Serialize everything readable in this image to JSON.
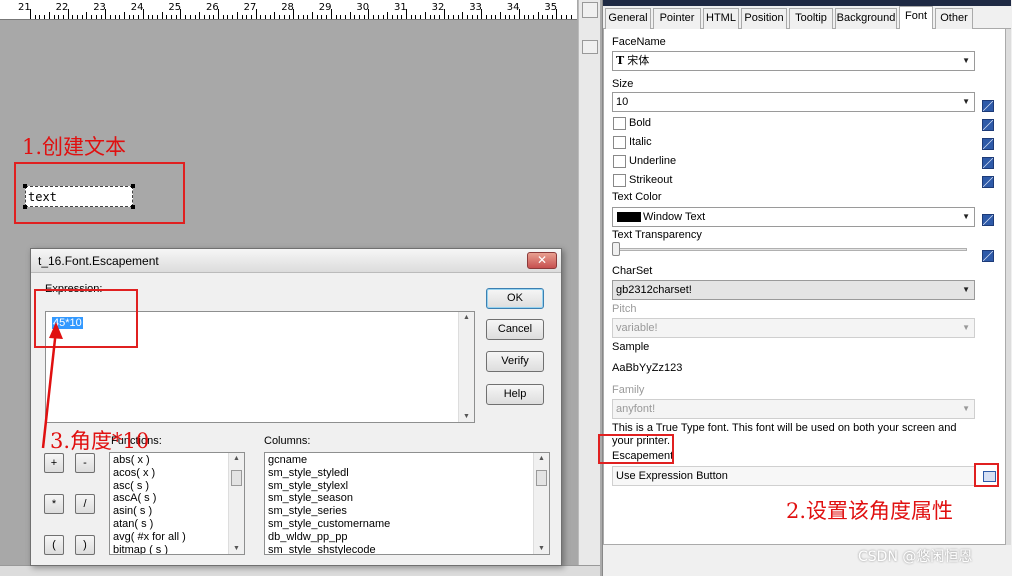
{
  "ruler": {
    "labels": [
      "21",
      "22",
      "23",
      "24",
      "25",
      "26",
      "27",
      "28",
      "29",
      "30",
      "31",
      "32",
      "33",
      "34",
      "35"
    ]
  },
  "canvas": {
    "text_control_value": "text"
  },
  "annotations": {
    "step1": "1.创建文本",
    "step2": "2.设置该角度属性",
    "step3": "3.角度*10"
  },
  "dialog": {
    "title": "t_16.Font.Escapement",
    "expression_label": "Expression:",
    "expression_value": "45*10",
    "functions_label": "Functions:",
    "columns_label": "Columns:",
    "buttons": {
      "ok": "OK",
      "cancel": "Cancel",
      "verify": "Verify",
      "help": "Help"
    },
    "operators": [
      "+",
      "-",
      "*",
      "/",
      "(",
      ")"
    ],
    "functions": [
      "abs( x )",
      "acos( x )",
      "asc( s )",
      "ascA( s )",
      "asin( s )",
      "atan( s )",
      "avg( #x for all )",
      "bitmap ( s )"
    ],
    "columns": [
      "gcname",
      "sm_style_styledl",
      "sm_style_stylexl",
      "sm_style_season",
      "sm_style_series",
      "sm_style_customername",
      "db_wldw_pp_pp",
      "sm_style_shstylecode"
    ]
  },
  "properties": {
    "tabs": [
      "General",
      "Pointer",
      "HTML",
      "Position",
      "Tooltip",
      "Background",
      "Font",
      "Other"
    ],
    "active_tab": "Font",
    "facename_label": "FaceName",
    "facename_value": "宋体",
    "size_label": "Size",
    "size_value": "10",
    "bold_label": "Bold",
    "italic_label": "Italic",
    "underline_label": "Underline",
    "strikeout_label": "Strikeout",
    "text_color_label": "Text Color",
    "text_color_value": "Window Text",
    "text_color_swatch": "#000000",
    "transparency_label": "Text Transparency",
    "transparency_value": 0,
    "charset_label": "CharSet",
    "charset_value": "gb2312charset!",
    "pitch_label": "Pitch",
    "pitch_value": "variable!",
    "sample_label": "Sample",
    "sample_value": "AaBbYyZz123",
    "family_label": "Family",
    "family_value": "anyfont!",
    "truetype_note": "This is a True Type font. This font will be used on both your screen and your printer.",
    "escapement_label": "Escapement",
    "escapement_value": "Use Expression Button"
  },
  "watermark": "CSDN @悠闲恒恩"
}
